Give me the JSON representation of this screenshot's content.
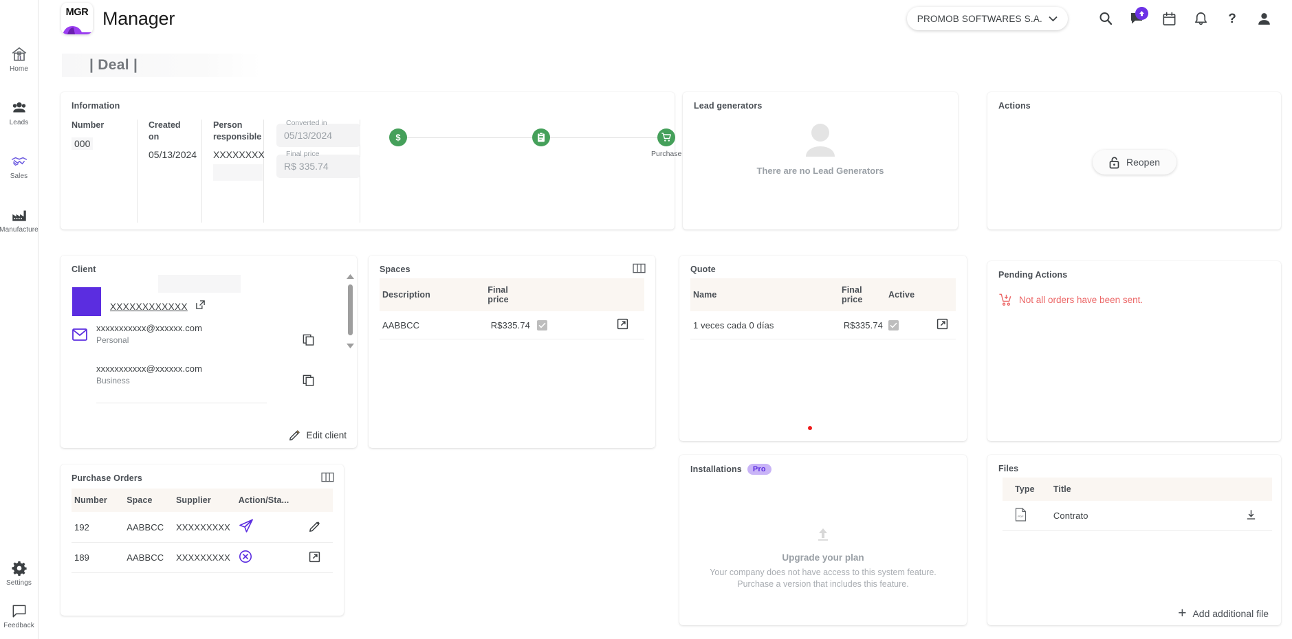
{
  "app": {
    "logo_text": "MGR",
    "brand_name": "Manager",
    "page_title": "| Deal |"
  },
  "topbar": {
    "company": "PROMOB SOFTWARES S.A.",
    "icons": [
      {
        "name": "search-icon"
      },
      {
        "name": "chat-upload-icon"
      },
      {
        "name": "calendar-icon"
      },
      {
        "name": "bell-icon"
      },
      {
        "name": "help-icon"
      },
      {
        "name": "account-icon"
      }
    ]
  },
  "sidebar": {
    "items": [
      {
        "label": "Home",
        "icon": "home-icon"
      },
      {
        "label": "Leads",
        "icon": "people-icon"
      },
      {
        "label": "Sales",
        "icon": "handshake-icon"
      },
      {
        "label": "Manufacture",
        "icon": "factory-icon"
      }
    ],
    "bottom_items": [
      {
        "label": "Settings",
        "icon": "gear-icon"
      },
      {
        "label": "Feedback",
        "icon": "speech-bubble-icon"
      }
    ]
  },
  "information": {
    "title": "Information",
    "columns": [
      {
        "label": "Number",
        "value": "000"
      },
      {
        "label": "Created on",
        "value": "05/13/2024"
      },
      {
        "label": "Person responsible",
        "value": "XXXXXXXX"
      }
    ],
    "fields": [
      {
        "label": "Converted in",
        "value": "05/13/2024"
      },
      {
        "label": "Final price",
        "value": "R$ 335.74"
      }
    ],
    "steps": [
      {
        "icon": "dollar-icon",
        "label": ""
      },
      {
        "icon": "clipboard-icon",
        "label": ""
      },
      {
        "icon": "cart-icon",
        "label": "Purchase"
      }
    ],
    "step_color": "#45a05a"
  },
  "lead_generators": {
    "title": "Lead generators",
    "empty_text": "There are no Lead Generators"
  },
  "actions": {
    "title": "Actions",
    "reopen_label": "Reopen"
  },
  "client": {
    "title": "Client",
    "name": "XXXXXXXXXXXX",
    "emails": [
      {
        "address": "xxxxxxxxxxx@xxxxxx.com",
        "type": "Personal"
      },
      {
        "address": "xxxxxxxxxxx@xxxxxx.com",
        "type": "Business"
      }
    ],
    "edit_label": "Edit client",
    "avatar_color": "#5b2de0"
  },
  "purchase_orders": {
    "title": "Purchase Orders",
    "headers": [
      "Number",
      "Space",
      "Supplier",
      "Action/Sta...",
      ""
    ],
    "rows": [
      {
        "number": "192",
        "space": "AABBCC",
        "supplier": "XXXXXXXXX",
        "status_icon": "send-icon",
        "action_icon": "pencil-icon"
      },
      {
        "number": "189",
        "space": "AABBCC",
        "supplier": "XXXXXXXXX",
        "status_icon": "cancel-circle-icon",
        "action_icon": "open-external-icon"
      }
    ]
  },
  "spaces": {
    "title": "Spaces",
    "headers": [
      "Description",
      "Final price",
      "",
      ""
    ],
    "rows": [
      {
        "description": "AABBCC",
        "final_price": "R$335.74",
        "checked": true,
        "action_icon": "open-external-icon"
      }
    ]
  },
  "quote": {
    "title": "Quote",
    "headers": [
      "Name",
      "Final price",
      "Active",
      ""
    ],
    "rows": [
      {
        "name": "1 veces cada 0 días",
        "final_price": "R$335.74",
        "active": true,
        "action_icon": "open-external-icon"
      }
    ]
  },
  "installations": {
    "title": "Installations",
    "badge": "Pro",
    "upgrade_title": "Upgrade your plan",
    "upgrade_text": "Your company does not have access to this system feature. Purchase a version that includes this feature."
  },
  "pending_actions": {
    "title": "Pending Actions",
    "message": "Not all orders have been sent.",
    "message_color": "#ec6767"
  },
  "files": {
    "title": "Files",
    "headers": [
      "Type",
      "Title",
      ""
    ],
    "rows": [
      {
        "type_icon": "pdf-file-icon",
        "title": "Contrato",
        "action_icon": "download-icon"
      }
    ],
    "add_label": "Add additional file"
  }
}
